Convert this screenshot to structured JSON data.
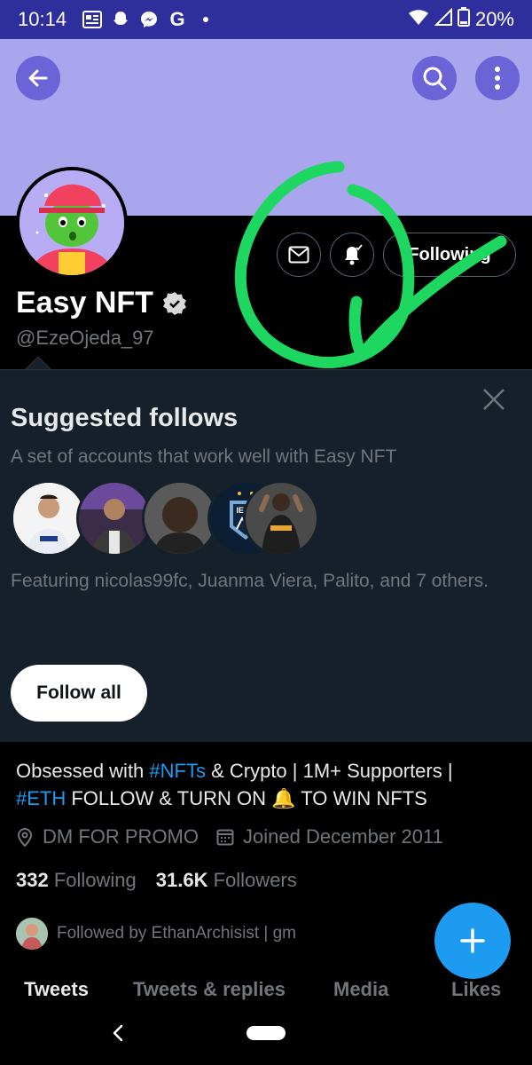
{
  "status_bar": {
    "time": "10:14",
    "battery": "20%",
    "notification_icons": [
      "news-icon",
      "snapchat-icon",
      "messenger-icon",
      "google-icon",
      "dot-icon"
    ]
  },
  "profile": {
    "display_name": "Easy NFT",
    "handle": "@EzeOjeda_97",
    "following_button": "Following",
    "verified": true
  },
  "suggested": {
    "title": "Suggested follows",
    "subtitle": "A set of accounts that work well with Easy NFT",
    "featuring": "Featuring nicolas99fc, Juanma Viera, Palito, and 7 others.",
    "follow_all": "Follow all"
  },
  "bio": {
    "part1": "Obsessed with ",
    "tag1": "#NFTs",
    "part2": " & Crypto | 1M+ Supporters |",
    "tag2": "#ETH",
    "part3": " FOLLOW & TURN ON ",
    "emoji": "🔔",
    "part4": " TO WIN NFTS"
  },
  "meta": {
    "location": "DM FOR PROMO",
    "joined": "Joined December 2011"
  },
  "counts": {
    "following_count": "332",
    "following_label": "Following",
    "followers_count": "31.6K",
    "followers_label": "Followers"
  },
  "followed_by": "Followed by EthanArchisist | gm",
  "tabs": [
    "Tweets",
    "Tweets & replies",
    "Media",
    "Likes"
  ],
  "colors": {
    "accent": "#1d9bf0",
    "banner": "#a9a6ee",
    "status_bar": "#2e2e9c",
    "annotation": "#1ed760"
  }
}
